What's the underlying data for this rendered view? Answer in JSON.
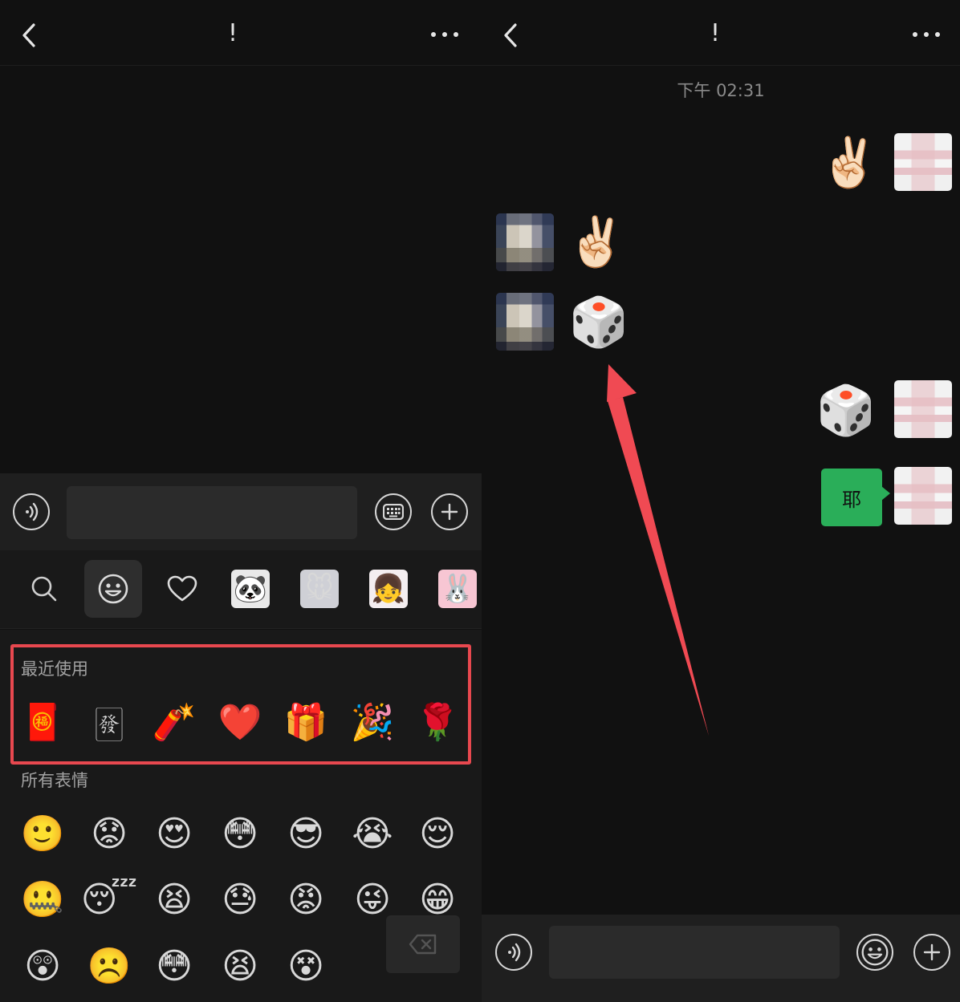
{
  "left": {
    "header": {
      "title": "!"
    },
    "composer": {
      "input_value": ""
    },
    "recent": {
      "title": "最近使用",
      "items": [
        "🧧",
        "🀅",
        "🧨",
        "❤️",
        "🎁",
        "🎉",
        "🌹"
      ]
    },
    "all": {
      "title": "所有表情",
      "rows": [
        [
          "🙂",
          "😟",
          "😍",
          "😳",
          "😎",
          "😭",
          "😌"
        ],
        [
          "🤐",
          "😴",
          "😫",
          "😓",
          "😡",
          "😜",
          "😁"
        ],
        [
          "😲",
          "☹️",
          "😳",
          "😫",
          "😵"
        ]
      ]
    },
    "stickers": [
      "🐼",
      "🐭",
      "👧",
      "🐰"
    ]
  },
  "right": {
    "header": {
      "title": "!"
    },
    "timestamp": "下午 02:31",
    "messages": {
      "m1": "✌🏻",
      "m2": "✌🏻",
      "m3": "🎲",
      "m4": "🎲",
      "m5": "耶"
    },
    "composer": {
      "input_value": ""
    }
  },
  "colors": {
    "accent_green": "#2aae59",
    "highlight_red": "#e8484f",
    "arrow_red": "#f04a53"
  }
}
